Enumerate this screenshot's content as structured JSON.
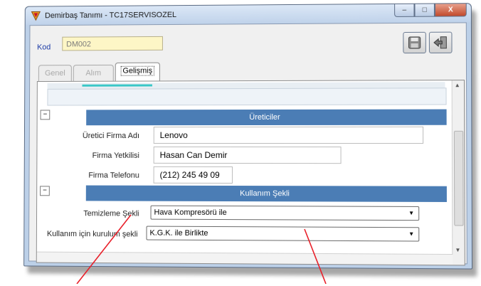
{
  "window": {
    "title": "Demirbaş Tanımı - TC17SERVISOZEL",
    "minimize_label": "–",
    "maximize_label": "□",
    "close_label": "X"
  },
  "header": {
    "kod_label": "Kod",
    "kod_value": "DM002"
  },
  "tabs": [
    {
      "label": "Genel",
      "active": false
    },
    {
      "label": "Alım",
      "active": false
    },
    {
      "label": "Gelişmiş",
      "active": true
    }
  ],
  "sections": {
    "ureticiler": {
      "title": "Üreticiler",
      "fields": [
        {
          "label": "Üretici Firma Adı",
          "value": "Lenovo"
        },
        {
          "label": "Firma Yetkilisi",
          "value": "Hasan Can Demir"
        },
        {
          "label": "Firma Telefonu",
          "value": "(212) 245 49 09"
        }
      ]
    },
    "kullanim": {
      "title": "Kullanım Şekli",
      "fields": [
        {
          "label": "Temizleme Şekli",
          "value": "Hava Kompresörü ile"
        },
        {
          "label": "Kullanım için kurulum şekli",
          "value": "K.G.K. ile Birlikte"
        }
      ]
    }
  },
  "colors": {
    "section_bar": "#4b7db5",
    "annotation_arrow": "#e8202a",
    "kod_field_bg": "#fdf6c6"
  }
}
